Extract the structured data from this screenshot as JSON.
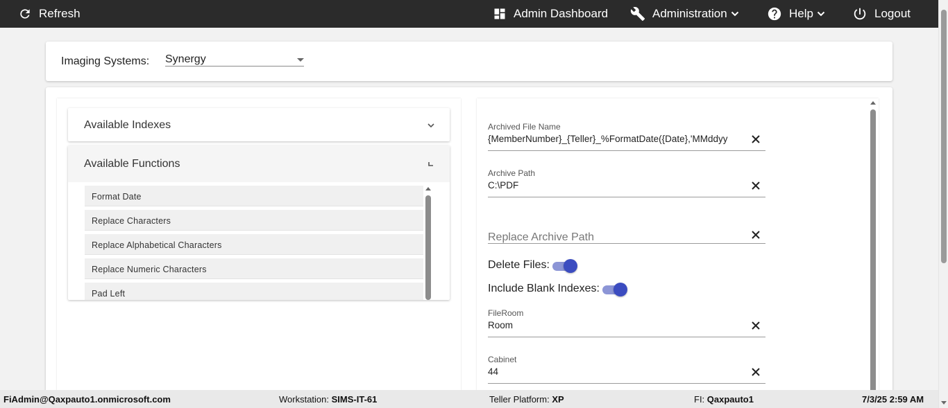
{
  "nav": {
    "refresh": "Refresh",
    "admin_dashboard": "Admin Dashboard",
    "administration": "Administration",
    "help": "Help",
    "logout": "Logout"
  },
  "imaging": {
    "label": "Imaging Systems:",
    "selected": "Synergy"
  },
  "left": {
    "indexes_title": "Available Indexes",
    "functions_title": "Available Functions",
    "functions": [
      "Format Date",
      "Replace Characters",
      "Replace Alphabetical Characters",
      "Replace Numeric Characters",
      "Pad Left"
    ]
  },
  "form": {
    "archived_file_name": {
      "label": "Archived File Name",
      "value": "{MemberNumber}_{Teller}_%FormatDate({Date},'MMddyy"
    },
    "archive_path": {
      "label": "Archive Path",
      "value": "C:\\PDF"
    },
    "replace_archive_path": {
      "placeholder": "Replace Archive Path"
    },
    "delete_files": {
      "label": "Delete Files:",
      "on": true
    },
    "include_blank_indexes": {
      "label": "Include Blank Indexes:",
      "on": true
    },
    "fileroom": {
      "label": "FileRoom",
      "value": "Room"
    },
    "cabinet": {
      "label": "Cabinet",
      "value": "44"
    }
  },
  "status": {
    "user": "FiAdmin@Qaxpauto1.onmicrosoft.com",
    "workstation_label": "Workstation:",
    "workstation": "SIMS-IT-61",
    "platform_label": "Teller Platform:",
    "platform": "XP",
    "fi_label": "FI:",
    "fi": "Qaxpauto1",
    "datetime": "7/3/25 2:59 AM"
  },
  "colors": {
    "topbar": "#2b2b2b",
    "toggle_knob": "#3b4cc0",
    "toggle_track": "#8c95d6"
  },
  "icons": [
    "refresh-icon",
    "dashboard-icon",
    "wrench-icon",
    "help-icon",
    "power-icon",
    "chevron-down-icon",
    "close-icon"
  ]
}
